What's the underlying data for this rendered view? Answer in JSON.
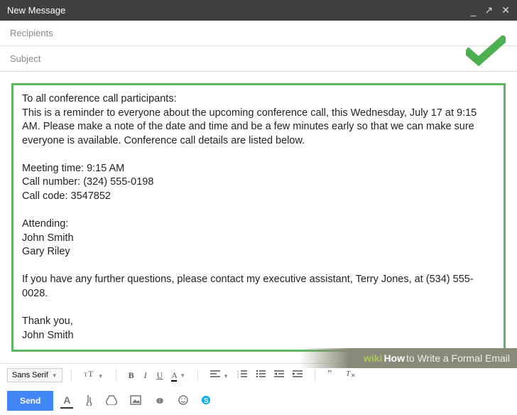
{
  "titlebar": {
    "title": "New Message"
  },
  "fields": {
    "recipients_placeholder": "Recipients",
    "subject_placeholder": "Subject"
  },
  "body": "To all conference call participants:\nThis is a reminder to everyone about the upcoming conference call, this Wednesday, July 17 at 9:15 AM. Please make a note of the date and time and be a few minutes early so that we can make sure everyone is available. Conference call details are listed below.\n\nMeeting time: 9:15 AM\nCall number: (324) 555-0198\nCall code: 3547852\n\nAttending:\nJohn Smith\nGary Riley\n\nIf you have any further questions, please contact my executive assistant, Terry Jones, at (534) 555-0028.\n\nThank you,\nJohn Smith",
  "toolbar": {
    "font": "Sans Serif",
    "size_icon": "тT",
    "bold": "B",
    "italic": "I",
    "underline": "U",
    "textcolor": "A"
  },
  "send_label": "Send",
  "bottom": {
    "format": "A"
  },
  "caption": {
    "wiki": "wiki",
    "how": "How",
    "text": " to Write a Formal Email"
  }
}
